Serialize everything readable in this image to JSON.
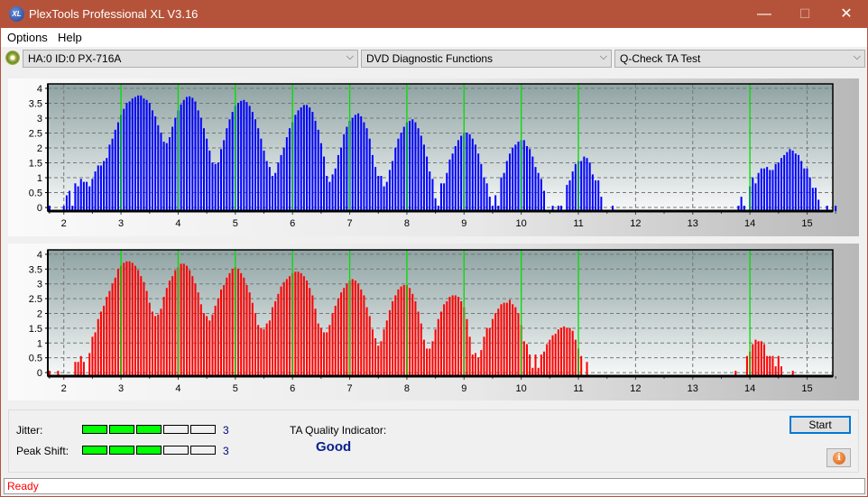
{
  "window": {
    "title": "PlexTools Professional XL V3.16",
    "logo_text": "XL",
    "controls": {
      "minimize": "—",
      "maximize": "☐",
      "close": "✕"
    }
  },
  "menu": {
    "items": [
      "Options",
      "Help"
    ]
  },
  "toolbar": {
    "drive": "HA:0 ID:0  PX-716A",
    "function": "DVD Diagnostic Functions",
    "test": "Q-Check TA Test",
    "dropdown_glyph": "⌵"
  },
  "results": {
    "jitter_label": "Jitter:",
    "jitter_value": "3",
    "jitter_level": 3,
    "peak_shift_label": "Peak Shift:",
    "peak_shift_value": "3",
    "peak_shift_level": 3,
    "meter_max": 5,
    "ta_quality_label": "TA Quality Indicator:",
    "ta_quality_value": "Good"
  },
  "buttons": {
    "start": "Start",
    "info_glyph": "i"
  },
  "status": {
    "text": "Ready"
  },
  "colors": {
    "top_bars": "#0000ff",
    "bottom_bars": "#ff0000",
    "marker_lines": "#00e000",
    "status_text": "#ff0000",
    "quality_text": "#0a1f8f",
    "meter_on": "#00ff00"
  },
  "chart_data": [
    {
      "type": "bar",
      "name": "top-chart",
      "title": "",
      "xlabel": "",
      "ylabel": "",
      "xlim": [
        1.72,
        15.45
      ],
      "ylim": [
        -0.12,
        4.15
      ],
      "xticks": [
        2,
        3,
        4,
        5,
        6,
        7,
        8,
        9,
        10,
        11,
        12,
        13,
        14,
        15
      ],
      "yticks": [
        0,
        0.5,
        1,
        1.5,
        2,
        2.5,
        3,
        3.5,
        4
      ],
      "ytick_labels": [
        "0",
        "0.5",
        "1",
        "1.5",
        "2",
        "2.5",
        "3",
        "3.5",
        "4"
      ],
      "grid": true,
      "marker_lines": [
        3,
        4,
        5,
        6,
        7,
        8,
        9,
        10,
        11,
        14
      ],
      "color": "#0000ff",
      "x_start": 1.75,
      "x_step": 0.05,
      "values": [
        0,
        -1,
        -1,
        -1,
        -1,
        0,
        0.35,
        0.5,
        0,
        0.75,
        0.65,
        0.9,
        0.8,
        0.8,
        0.65,
        0.9,
        1.15,
        1.35,
        1.35,
        1.5,
        1.6,
        2.05,
        2.25,
        2.55,
        2.8,
        3.05,
        3.25,
        3.45,
        3.5,
        3.6,
        3.65,
        3.7,
        3.7,
        3.6,
        3.55,
        3.45,
        3.2,
        3.0,
        2.7,
        2.45,
        2.15,
        2.1,
        2.3,
        2.65,
        2.95,
        3.2,
        3.4,
        3.55,
        3.65,
        3.67,
        3.62,
        3.5,
        3.2,
        2.95,
        2.6,
        2.25,
        1.85,
        1.45,
        1.4,
        1.45,
        1.9,
        2.2,
        2.6,
        2.9,
        3.15,
        3.35,
        3.45,
        3.52,
        3.55,
        3.48,
        3.35,
        3.15,
        2.9,
        2.6,
        2.25,
        1.85,
        1.5,
        1.3,
        1.0,
        1.1,
        1.45,
        1.7,
        1.95,
        2.3,
        2.6,
        2.8,
        3.05,
        3.2,
        3.3,
        3.38,
        3.38,
        3.3,
        3.15,
        2.85,
        2.55,
        2.1,
        1.65,
        1.0,
        0.8,
        1.05,
        1.25,
        1.7,
        1.95,
        2.4,
        2.65,
        2.85,
        2.95,
        3.05,
        3.1,
        3.0,
        2.8,
        2.6,
        2.25,
        1.7,
        1.3,
        1.0,
        1.0,
        0.65,
        0.8,
        1.2,
        1.5,
        1.95,
        2.25,
        2.45,
        2.65,
        2.8,
        2.85,
        2.9,
        2.8,
        2.6,
        2.35,
        2.05,
        1.65,
        1.15,
        0.9,
        0.25,
        0,
        0.75,
        0.75,
        1.1,
        1.55,
        1.75,
        2.0,
        2.2,
        2.35,
        2.45,
        2.45,
        2.4,
        2.25,
        2.05,
        1.75,
        1.4,
        0.95,
        0.75,
        0.3,
        0.0,
        0.35,
        0.0,
        0.95,
        1.1,
        1.5,
        1.75,
        1.95,
        2.05,
        2.15,
        2.2,
        2.2,
        2.0,
        1.9,
        1.65,
        1.3,
        1.1,
        0.9,
        0.5,
        -1,
        -1,
        0,
        -1,
        0,
        0,
        -1,
        0.7,
        0.85,
        1.15,
        1.4,
        1.5,
        1.5,
        1.65,
        1.6,
        1.45,
        1.05,
        0.85,
        0.85,
        0.3,
        -1,
        -1,
        -1,
        0,
        -1,
        -1,
        -1,
        -1,
        -1,
        -1,
        -1,
        -1,
        -1,
        -1,
        -1,
        -1,
        -1,
        -1,
        -1,
        -1,
        -1,
        -1,
        -1,
        -1,
        -1,
        -1,
        -1,
        -1,
        -1,
        -1,
        -1,
        -1,
        -1,
        -1,
        -1,
        -1,
        -1,
        -1,
        -1,
        -1,
        -1,
        -1,
        -1,
        -1,
        -1,
        -1,
        -1,
        0,
        0.3,
        0,
        -1,
        0.65,
        0.95,
        0.75,
        1.1,
        1.25,
        1.25,
        1.3,
        1.2,
        1.2,
        1.4,
        1.45,
        1.6,
        1.7,
        1.8,
        1.9,
        1.85,
        1.75,
        1.7,
        1.5,
        1.25,
        1.25,
        0.95,
        0.6,
        0.6,
        0.2,
        -1,
        -1,
        0,
        -1,
        -1,
        0
      ],
      "bars_note": "value -1 = no bar"
    },
    {
      "type": "bar",
      "name": "bottom-chart",
      "title": "",
      "xlabel": "",
      "ylabel": "",
      "xlim": [
        1.72,
        15.45
      ],
      "ylim": [
        -0.12,
        4.15
      ],
      "xticks": [
        2,
        3,
        4,
        5,
        6,
        7,
        8,
        9,
        10,
        11,
        12,
        13,
        14,
        15
      ],
      "yticks": [
        0,
        0.5,
        1,
        1.5,
        2,
        2.5,
        3,
        3.5,
        4
      ],
      "ytick_labels": [
        "0",
        "0.5",
        "1",
        "1.5",
        "2",
        "2.5",
        "3",
        "3.5",
        "4"
      ],
      "grid": true,
      "marker_lines": [
        3,
        4,
        5,
        6,
        7,
        8,
        9,
        10,
        11,
        14
      ],
      "color": "#ff0000",
      "x_start": 1.75,
      "x_step": 0.05,
      "values": [
        0,
        -1,
        -1,
        0,
        -1,
        -1,
        -1,
        -1,
        -1,
        0.3,
        0.3,
        0.5,
        0.3,
        -1,
        0.6,
        1.15,
        1.3,
        1.75,
        2.0,
        2.2,
        2.5,
        2.7,
        2.95,
        3.15,
        3.45,
        3.55,
        3.65,
        3.7,
        3.7,
        3.65,
        3.55,
        3.4,
        3.2,
        3.0,
        2.7,
        2.3,
        2.0,
        1.85,
        1.9,
        2.1,
        2.5,
        2.8,
        3.05,
        3.2,
        3.4,
        3.5,
        3.62,
        3.62,
        3.55,
        3.4,
        3.2,
        2.95,
        2.65,
        2.25,
        1.95,
        1.85,
        1.7,
        1.9,
        2.2,
        2.45,
        2.75,
        2.9,
        3.15,
        3.3,
        3.45,
        3.5,
        3.45,
        3.3,
        3.15,
        2.9,
        2.65,
        2.3,
        1.95,
        1.55,
        1.45,
        1.4,
        1.6,
        1.7,
        2.15,
        2.35,
        2.6,
        2.85,
        3.0,
        3.1,
        3.2,
        3.3,
        3.35,
        3.35,
        3.3,
        3.2,
        3.05,
        2.8,
        2.55,
        2.1,
        1.6,
        1.45,
        1.3,
        1.3,
        1.55,
        1.95,
        2.2,
        2.45,
        2.65,
        2.8,
        2.95,
        3.05,
        3.1,
        3.05,
        2.95,
        2.75,
        2.55,
        2.15,
        1.85,
        1.4,
        1.1,
        0.85,
        1.0,
        1.4,
        1.7,
        2.05,
        2.35,
        2.55,
        2.75,
        2.85,
        2.9,
        2.9,
        2.8,
        2.6,
        2.35,
        2.0,
        1.6,
        1.05,
        0.75,
        0.75,
        1.0,
        1.4,
        1.75,
        2.0,
        2.25,
        2.35,
        2.5,
        2.55,
        2.55,
        2.5,
        2.35,
        2.15,
        1.75,
        1.15,
        0.55,
        0.6,
        0.45,
        0.7,
        1.15,
        1.45,
        1.45,
        1.75,
        1.95,
        2.1,
        2.25,
        2.3,
        2.3,
        2.4,
        2.25,
        2.15,
        1.95,
        1.55,
        1.0,
        0.9,
        0.55,
        0.1,
        0.55,
        0.1,
        0.55,
        0.65,
        0.9,
        1.05,
        1.2,
        1.25,
        1.4,
        1.45,
        1.5,
        1.45,
        1.45,
        1.35,
        1.05,
        0.75,
        0.5,
        -1,
        0.3,
        -1,
        -1,
        -1,
        -1,
        -1,
        -1,
        -1,
        -1,
        -1,
        -1,
        -1,
        -1,
        -1,
        -1,
        -1,
        -1,
        -1,
        -1,
        -1,
        -1,
        -1,
        -1,
        -1,
        -1,
        -1,
        -1,
        -1,
        -1,
        -1,
        -1,
        -1,
        -1,
        -1,
        -1,
        -1,
        -1,
        -1,
        -1,
        -1,
        -1,
        -1,
        -1,
        -1,
        -1,
        -1,
        -1,
        -1,
        -1,
        -1,
        -1,
        -1,
        0,
        -1,
        -1,
        -1,
        0.5,
        0.65,
        0.9,
        1.05,
        1.0,
        1.0,
        0.9,
        0.5,
        0.5,
        0.5,
        0.15,
        0.5,
        0.15,
        -1,
        -1,
        -1,
        0,
        -1
      ],
      "bars_note": "value -1 = no bar"
    }
  ]
}
